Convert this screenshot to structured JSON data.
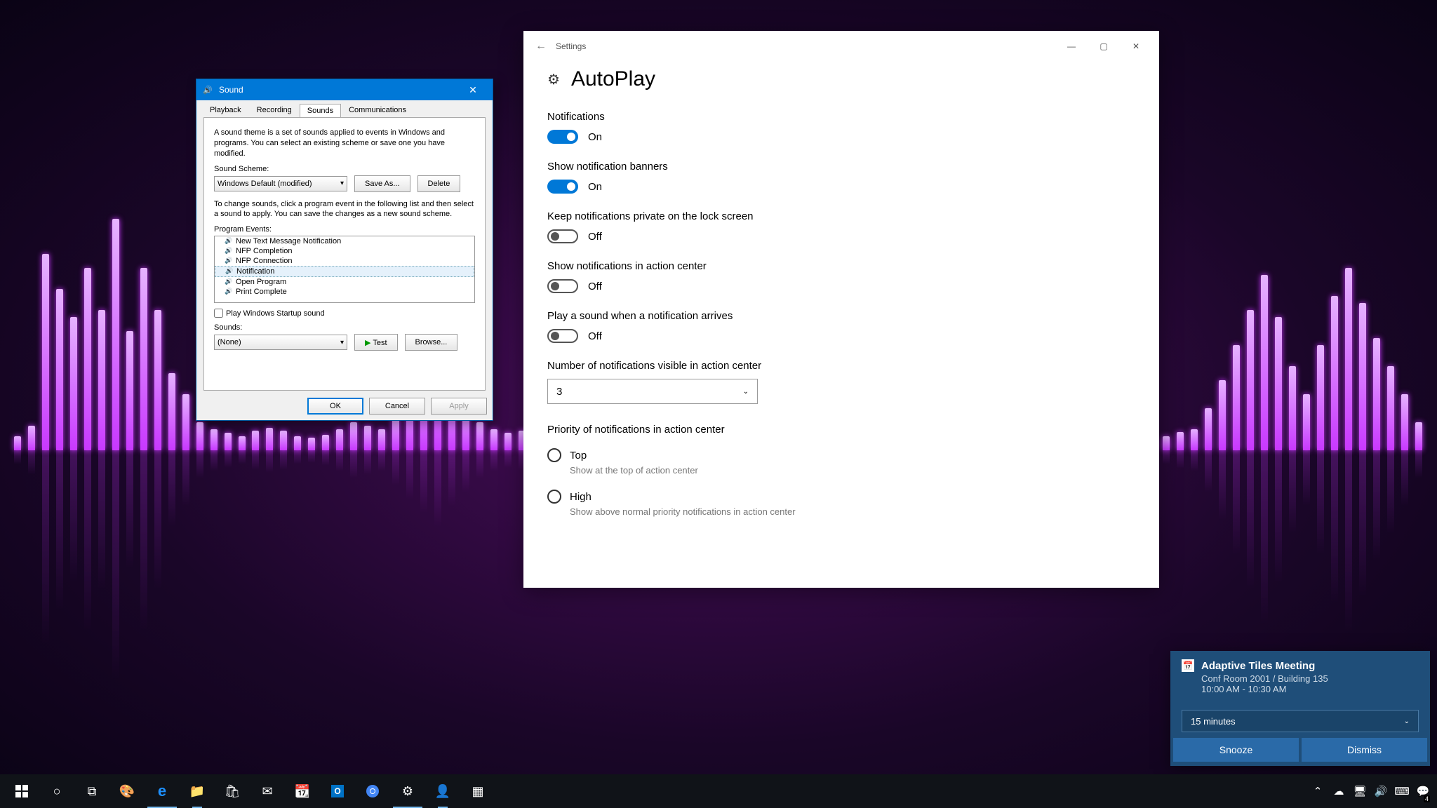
{
  "sound_dialog": {
    "title": "Sound",
    "tabs": [
      "Playback",
      "Recording",
      "Sounds",
      "Communications"
    ],
    "active_tab": "Sounds",
    "description": "A sound theme is a set of sounds applied to events in Windows and programs.  You can select an existing scheme or save one you have modified.",
    "scheme_label": "Sound Scheme:",
    "scheme_value": "Windows Default (modified)",
    "save_as": "Save As...",
    "delete": "Delete",
    "change_desc": "To change sounds, click a program event in the following list and then select a sound to apply.  You can save the changes as a new sound scheme.",
    "events_label": "Program Events:",
    "events": [
      "New Text Message Notification",
      "NFP Completion",
      "NFP Connection",
      "Notification",
      "Open Program",
      "Print Complete"
    ],
    "selected_event": "Notification",
    "startup_checkbox": "Play Windows Startup sound",
    "sounds_label": "Sounds:",
    "sounds_value": "(None)",
    "test": "Test",
    "browse": "Browse...",
    "ok": "OK",
    "cancel": "Cancel",
    "apply": "Apply"
  },
  "settings_window": {
    "titlebar": "Settings",
    "heading": "AutoPlay",
    "notifications_title": "Notifications",
    "toggles": [
      {
        "label_title": "Notifications",
        "state": "on",
        "state_text": "On"
      },
      {
        "label_title": "Show notification banners",
        "state": "on",
        "state_text": "On"
      },
      {
        "label_title": "Keep notifications private on the lock screen",
        "state": "off",
        "state_text": "Off"
      },
      {
        "label_title": "Show notifications in action center",
        "state": "off",
        "state_text": "Off"
      },
      {
        "label_title": "Play a sound when a notification arrives",
        "state": "off",
        "state_text": "Off"
      }
    ],
    "count_label": "Number of notifications visible in action center",
    "count_value": "3",
    "priority_label": "Priority of notifications in action center",
    "priority_options": [
      {
        "label": "Top",
        "desc": "Show at the top of action center"
      },
      {
        "label": "High",
        "desc": "Show above normal priority notifications in action center"
      }
    ]
  },
  "toast": {
    "title": "Adaptive Tiles Meeting",
    "line1": "Conf Room 2001 / Building 135",
    "line2": "10:00 AM - 10:30 AM",
    "snooze_value": "15 minutes",
    "snooze": "Snooze",
    "dismiss": "Dismiss"
  },
  "taskbar": {
    "tray_badge": "4"
  }
}
